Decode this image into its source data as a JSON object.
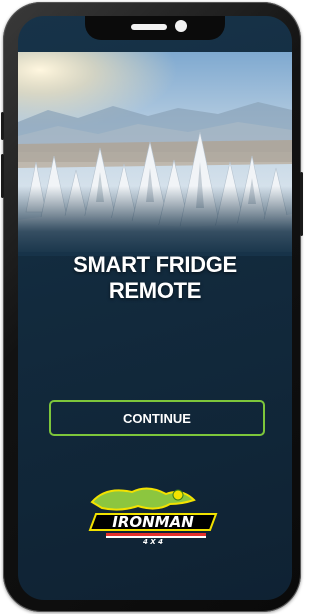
{
  "screen": {
    "title_line1": "SMART FRIDGE",
    "title_line2": "REMOTE",
    "continue_label": "CONTINUE"
  },
  "logo": {
    "brand": "IRONMAN",
    "sub": "4 X 4"
  },
  "colors": {
    "accent": "#7dc63b",
    "background": "#173349",
    "text": "#ffffff"
  },
  "icons": {
    "hero": "snowy-forest-image",
    "brand": "ironman-4x4-logo"
  }
}
